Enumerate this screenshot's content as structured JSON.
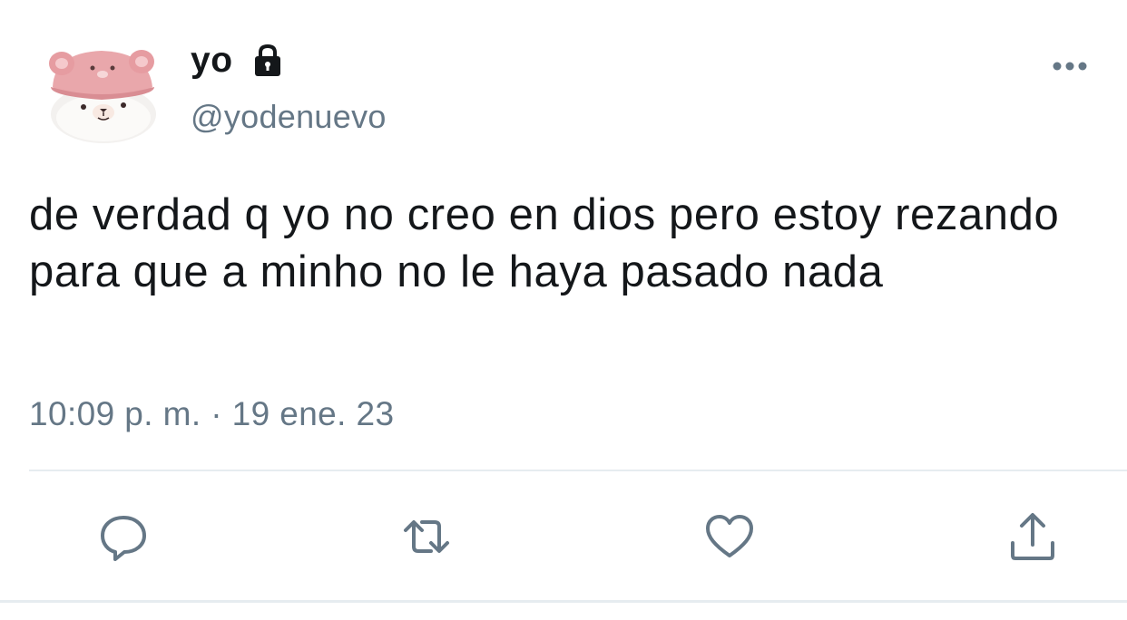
{
  "tweet": {
    "display_name": "yo",
    "handle": "@yodenuevo",
    "text": "de verdad q yo no creo en dios pero estoy rezando para que a minho no le haya pasado nada",
    "timestamp": "10:09 p. m. · 19 ene. 23"
  },
  "icons": {
    "lock": "lock-icon",
    "more": "more-options-icon",
    "reply": "reply-icon",
    "retweet": "retweet-icon",
    "like": "heart-icon",
    "share": "share-icon"
  },
  "colors": {
    "text_primary": "#14171a",
    "text_secondary": "#657786",
    "icon_gray": "#657786",
    "divider": "#e6ecf0",
    "avatar_pink": "#e8a3a8"
  }
}
